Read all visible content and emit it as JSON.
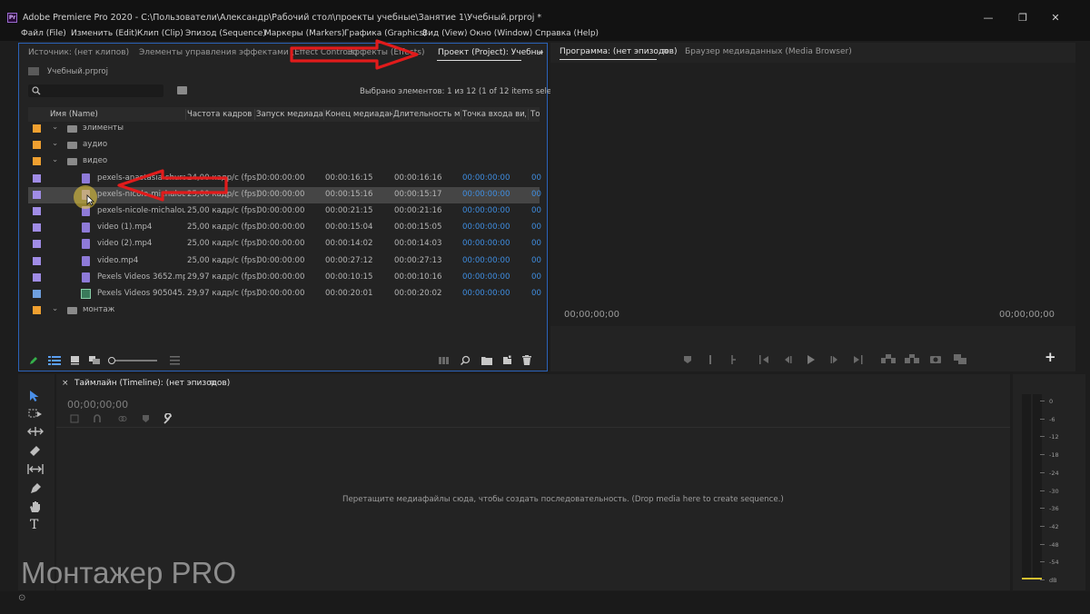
{
  "window": {
    "app_logo": "Pr",
    "title": "Adobe Premiere Pro 2020 - C:\\Пользователи\\Александр\\Рабочий стол\\проекты учебные\\Занятие 1\\Учебный.prproj *",
    "minimize": "—",
    "restore": "❐",
    "close": "✕"
  },
  "menu": [
    "Файл (File)",
    "Изменить (Edit)",
    "Клип (Clip)",
    "Эпизод (Sequence)",
    "Маркеры (Markers)",
    "Графика (Graphics)",
    "Вид (View)",
    "Окно (Window)",
    "Справка (Help)"
  ],
  "project_panel": {
    "tabs": [
      "Источник: (нет клипов)",
      "Элементы управления эффектами (Effect Controls)",
      "Эффекты (Effects)",
      "Проект (Project): Учебны"
    ],
    "overflow": "»",
    "project_file": "Учебный.prproj",
    "search_placeholder": "",
    "selection_info": "Выбрано элементов: 1 из 12 (1 of 12 items selected)",
    "columns": [
      "Имя (Name)",
      "Частота кадров (F",
      "Запуск медиадан",
      "Конец медиаданн",
      "Длительность ме",
      "Точка входа виде",
      "То"
    ],
    "rows": [
      {
        "name": "элименты",
        "type": "bin",
        "expanded": true,
        "indent": 0,
        "color": "#f0a030",
        "fps": "",
        "start": "",
        "end": "",
        "dur": "",
        "in": "",
        "tail": ""
      },
      {
        "name": "аудио",
        "type": "bin",
        "expanded": true,
        "indent": 0,
        "color": "#f0a030",
        "fps": "",
        "start": "",
        "end": "",
        "dur": "",
        "in": "",
        "tail": ""
      },
      {
        "name": "видео",
        "type": "bin",
        "expanded": true,
        "indent": 0,
        "color": "#f0a030",
        "fps": "",
        "start": "",
        "end": "",
        "dur": "",
        "in": "",
        "tail": ""
      },
      {
        "name": "pexels-anastasia-shura",
        "type": "clip",
        "indent": 1,
        "color": "#a08ce6",
        "fps": "24,00 кадр/с (fps)",
        "start": "00:00:00:00",
        "end": "00:00:16:15",
        "dur": "00:00:16:16",
        "in": "00:00:00:00",
        "tail": "00"
      },
      {
        "name": "pexels-nicole-michalou-",
        "type": "clip",
        "indent": 1,
        "color": "#a08ce6",
        "fps": "25,00 кадр/с (fps)",
        "start": "00:00:00:00",
        "end": "00:00:15:16",
        "dur": "00:00:15:17",
        "in": "00:00:00:00",
        "tail": "00",
        "selected": true
      },
      {
        "name": "pexels-nicole-michalou-",
        "type": "clip",
        "indent": 1,
        "color": "#a08ce6",
        "fps": "25,00 кадр/с (fps)",
        "start": "00:00:00:00",
        "end": "00:00:21:15",
        "dur": "00:00:21:16",
        "in": "00:00:00:00",
        "tail": "00"
      },
      {
        "name": "video (1).mp4",
        "type": "clip",
        "indent": 1,
        "color": "#a08ce6",
        "fps": "25,00 кадр/с (fps)",
        "start": "00:00:00:00",
        "end": "00:00:15:04",
        "dur": "00:00:15:05",
        "in": "00:00:00:00",
        "tail": "00"
      },
      {
        "name": "video (2).mp4",
        "type": "clip",
        "indent": 1,
        "color": "#a08ce6",
        "fps": "25,00 кадр/с (fps)",
        "start": "00:00:00:00",
        "end": "00:00:14:02",
        "dur": "00:00:14:03",
        "in": "00:00:00:00",
        "tail": "00"
      },
      {
        "name": "video.mp4",
        "type": "clip",
        "indent": 1,
        "color": "#a08ce6",
        "fps": "25,00 кадр/с (fps)",
        "start": "00:00:00:00",
        "end": "00:00:27:12",
        "dur": "00:00:27:13",
        "in": "00:00:00:00",
        "tail": "00"
      },
      {
        "name": "Pexels Videos 3652.mp",
        "type": "clip",
        "indent": 1,
        "color": "#a08ce6",
        "fps": "29,97 кадр/с (fps)",
        "start": "00:00:00:00",
        "end": "00:00:10:15",
        "dur": "00:00:10:16",
        "in": "00:00:00:00",
        "tail": "00"
      },
      {
        "name": "Pexels Videos 905045.",
        "type": "clip-green",
        "indent": 1,
        "color": "#6fa0e0",
        "fps": "29,97 кадр/с (fps)",
        "start": "00:00:00:00",
        "end": "00:00:20:01",
        "dur": "00:00:20:02",
        "in": "00:00:00:00",
        "tail": "00"
      },
      {
        "name": "монтаж",
        "type": "bin",
        "expanded": true,
        "indent": 0,
        "color": "#f0a030",
        "fps": "",
        "start": "",
        "end": "",
        "dur": "",
        "in": "",
        "tail": ""
      }
    ],
    "zoom_slider_value": 0.0
  },
  "program_panel": {
    "tabs": [
      "Программа: (нет эпизодов)",
      "Браузер медиаданных (Media Browser)"
    ],
    "menu_glyph": "≡",
    "timecode_left": "00;00;00;00",
    "timecode_right": "00;00;00;00",
    "add_button": "+"
  },
  "timeline_panel": {
    "close_glyph": "×",
    "tab": "Таймлайн (Timeline): (нет эпизодов)",
    "menu_glyph": "≡",
    "timecode": "00;00;00;00",
    "placeholder": "Перетащите медиафайлы сюда, чтобы создать последовательность. (Drop media here to create sequence.)"
  },
  "audio_meter": {
    "ticks": [
      "0",
      "-6",
      "-12",
      "-18",
      "-24",
      "-30",
      "-36",
      "-42",
      "-48",
      "-54",
      "dB"
    ]
  },
  "watermark": "Монтажер PRO",
  "status_glyph": "⊙",
  "annotation_colors": {
    "arrow": "#e11b1b",
    "focus_border": "#2b62b8",
    "bin": "#f0a030",
    "clip": "#a08ce6",
    "timecode_blue": "#3f8de0"
  }
}
